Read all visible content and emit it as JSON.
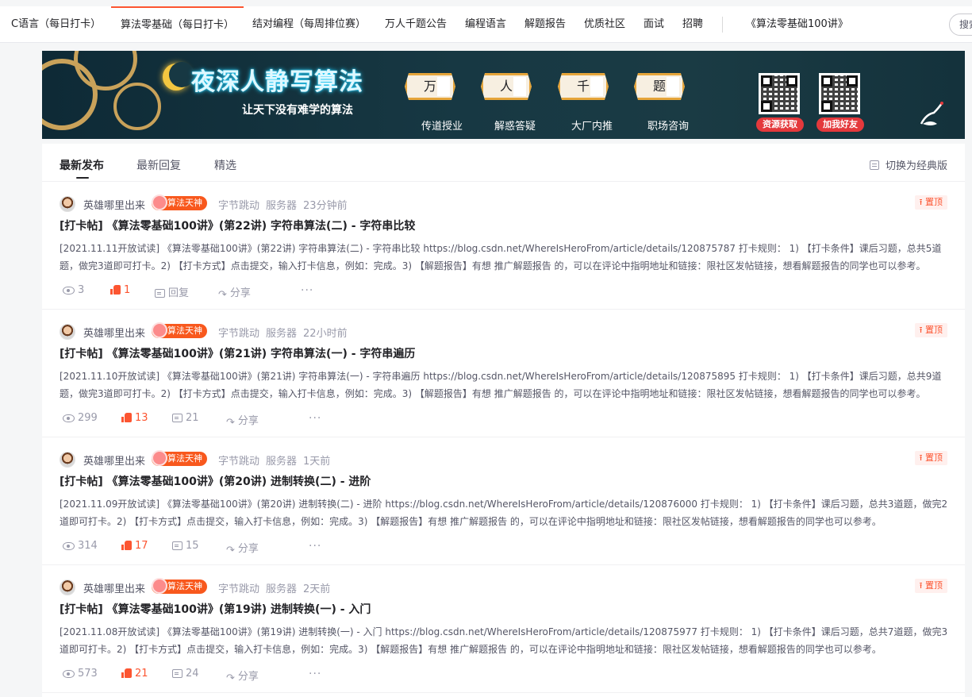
{
  "nav": {
    "items": [
      {
        "label": "C语言（每日打卡）"
      },
      {
        "label": "算法零基础（每日打卡）"
      },
      {
        "label": "结对编程（每周排位赛）"
      },
      {
        "label": "万人千题公告"
      },
      {
        "label": "编程语言"
      },
      {
        "label": "解题报告"
      },
      {
        "label": "优质社区"
      },
      {
        "label": "面试"
      },
      {
        "label": "招聘"
      },
      {
        "label": "《算法零基础100讲》"
      }
    ],
    "search_label": "搜索"
  },
  "banner": {
    "title": "夜深人静写算法",
    "subtitle": "让天下没有难学的算法",
    "tiles": [
      "万",
      "人",
      "千",
      "题"
    ],
    "labels": [
      "传道授业",
      "解惑答疑",
      "大厂内推",
      "职场咨询"
    ],
    "qr_buttons": [
      "资源获取",
      "加我好友"
    ]
  },
  "tabs": {
    "items": [
      {
        "label": "最新发布"
      },
      {
        "label": "最新回复"
      },
      {
        "label": "精选"
      }
    ],
    "switch_label": "切换为经典版"
  },
  "posts": [
    {
      "author": "英雄哪里出来",
      "badge": "算法天神",
      "tags": [
        "字节跳动",
        "服务器"
      ],
      "time": "23分钟前",
      "pin": "置顶",
      "title": "[打卡帖] 《算法零基础100讲》(第22讲) 字符串算法(二) - 字符串比较",
      "desc": "[2021.11.11开放试读] 《算法零基础100讲》(第22讲) 字符串算法(二) - 字符串比较 https://blog.csdn.net/WhereIsHeroFrom/article/details/120875787 打卡规则： 1) 【打卡条件】课后习题，总共5道题，做完3道即可打卡。2) 【打卡方式】点击提交，输入打卡信息，例如：完成。3) 【解题报告】有想 推广解题报告 的，可以在评论中指明地址和链接：限社区发帖链接，想看解题报告的同学也可以参考。",
      "views": "3",
      "likes": "1",
      "comments": "回复",
      "share": "分享",
      "more": "···"
    },
    {
      "author": "英雄哪里出来",
      "badge": "算法天神",
      "tags": [
        "字节跳动",
        "服务器"
      ],
      "time": "22小时前",
      "pin": "置顶",
      "title": "[打卡帖] 《算法零基础100讲》(第21讲) 字符串算法(一) - 字符串遍历",
      "desc": "[2021.11.10开放试读] 《算法零基础100讲》(第21讲) 字符串算法(一) - 字符串遍历 https://blog.csdn.net/WhereIsHeroFrom/article/details/120875895 打卡规则： 1) 【打卡条件】课后习题，总共9道题，做完3道即可打卡。2) 【打卡方式】点击提交，输入打卡信息，例如：完成。3) 【解题报告】有想 推广解题报告 的，可以在评论中指明地址和链接：限社区发帖链接，想看解题报告的同学也可以参考。",
      "views": "299",
      "likes": "13",
      "comments": "21",
      "share": "分享",
      "more": "···"
    },
    {
      "author": "英雄哪里出来",
      "badge": "算法天神",
      "tags": [
        "字节跳动",
        "服务器"
      ],
      "time": "1天前",
      "pin": "置顶",
      "title": "[打卡帖] 《算法零基础100讲》(第20讲) 进制转换(二) - 进阶",
      "desc": "[2021.11.09开放试读] 《算法零基础100讲》(第20讲) 进制转换(二) - 进阶 https://blog.csdn.net/WhereIsHeroFrom/article/details/120876000 打卡规则： 1) 【打卡条件】课后习题，总共3道题，做完2道即可打卡。2) 【打卡方式】点击提交，输入打卡信息，例如：完成。3) 【解题报告】有想 推广解题报告 的，可以在评论中指明地址和链接：限社区发帖链接，想看解题报告的同学也可以参考。",
      "views": "314",
      "likes": "17",
      "comments": "15",
      "share": "分享",
      "more": "···"
    },
    {
      "author": "英雄哪里出来",
      "badge": "算法天神",
      "tags": [
        "字节跳动",
        "服务器"
      ],
      "time": "2天前",
      "pin": "置顶",
      "title": "[打卡帖] 《算法零基础100讲》(第19讲) 进制转换(一) - 入门",
      "desc": "[2021.11.08开放试读] 《算法零基础100讲》(第19讲) 进制转换(一) - 入门 https://blog.csdn.net/WhereIsHeroFrom/article/details/120875977 打卡规则： 1) 【打卡条件】课后习题，总共7道题，做完3道即可打卡。2) 【打卡方式】点击提交，输入打卡信息，例如：完成。3) 【解题报告】有想 推广解题报告 的，可以在评论中指明地址和链接：限社区发帖链接，想看解题报告的同学也可以参考。",
      "views": "573",
      "likes": "21",
      "comments": "24",
      "share": "分享",
      "more": "···"
    }
  ],
  "colors": {
    "accent": "#fc5531",
    "badge": "#f8581d",
    "text_primary": "#222226",
    "text_secondary": "#555666",
    "text_muted": "#999aaa"
  }
}
